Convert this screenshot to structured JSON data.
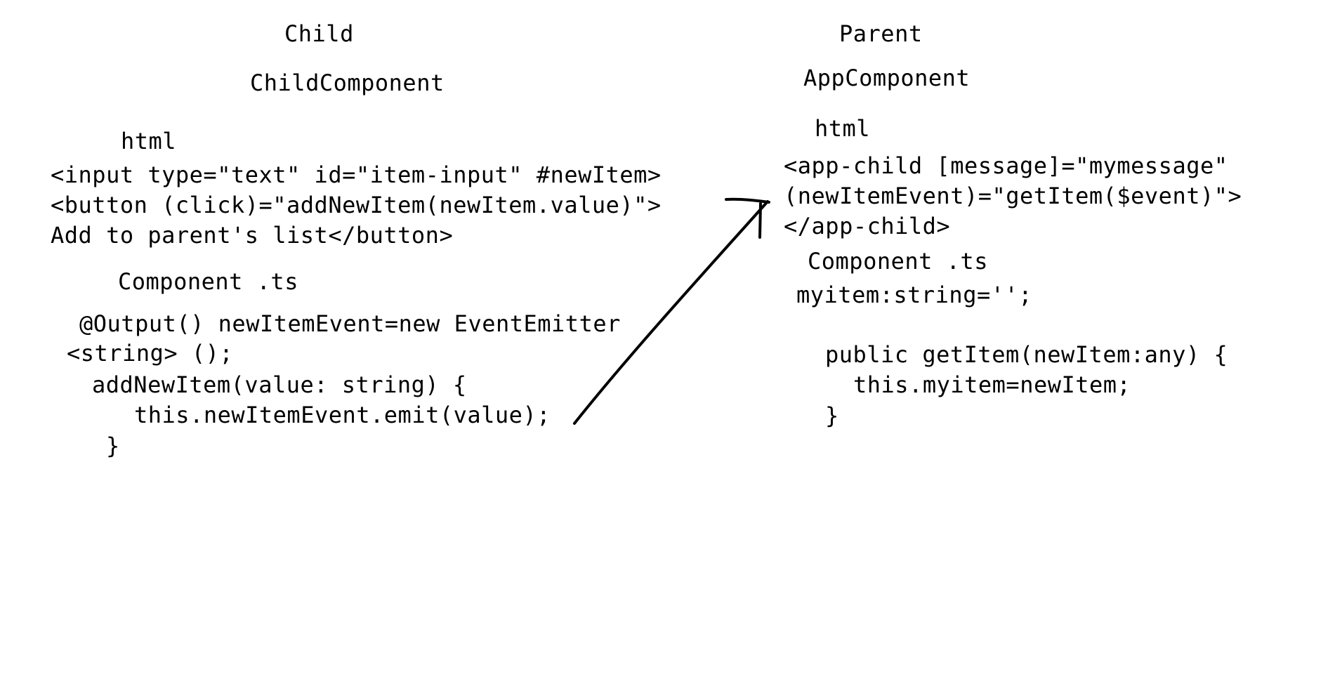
{
  "child": {
    "heading": "Child",
    "component_name": "ChildComponent",
    "html_label": "html",
    "html_code": [
      "<input type=\"text\" id=\"item-input\" #newItem>",
      "<button (click)=\"addNewItem(newItem.value)\">",
      "Add to parent's list</button>"
    ],
    "ts_label": "Component .ts",
    "ts_code": [
      "@Output() newItemEvent=new EventEmitter",
      "<string> ();",
      "addNewItem(value: string) {",
      "this.newItemEvent.emit(value);",
      "}"
    ]
  },
  "parent": {
    "heading": "Parent",
    "component_name": "AppComponent",
    "html_label": "html",
    "html_code": [
      "<app-child [message]=\"mymessage\"",
      "(newItemEvent)=\"getItem($event)\">",
      "</app-child>"
    ],
    "ts_label": "Component .ts",
    "ts_code": [
      "myitem:string='';",
      "public getItem(newItem:any) {",
      "this.myitem=newItem;",
      "}"
    ]
  },
  "colors": {
    "text": "#000000",
    "background": "#ffffff",
    "arrow": "#000000"
  }
}
